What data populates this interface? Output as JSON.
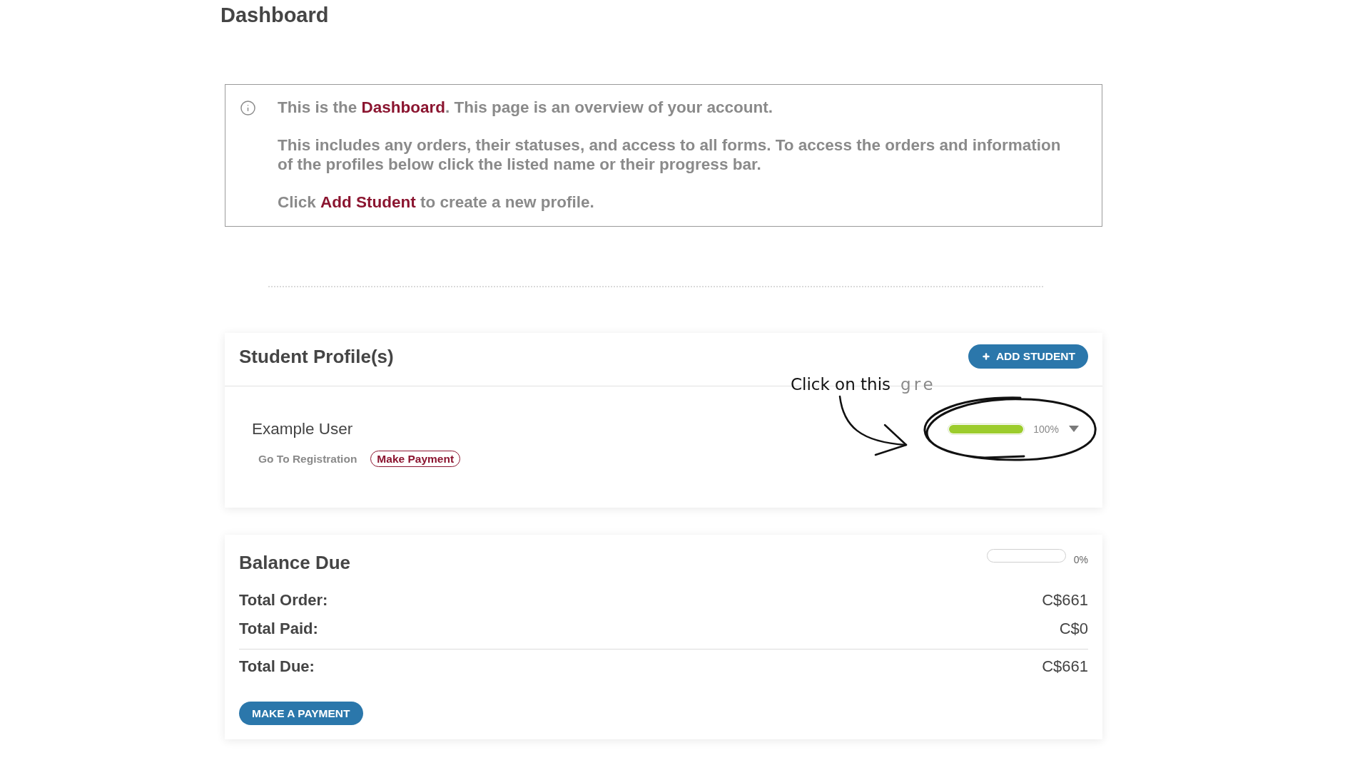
{
  "page_title": "Dashboard",
  "info_box": {
    "paragraphs": [
      "This is the **Dashboard**. This page is an overview of your account.",
      "This includes any orders, their statuses, and access to all forms. To access the orders and information of the profiles below click the listed name or their progress bar.",
      "Click **Add Student** to create a new profile."
    ]
  },
  "student_profiles": {
    "title": "Student Profile(s)",
    "add_button": {
      "label": "ADD STUDENT"
    },
    "students": [
      {
        "name": "Example User",
        "actions": [
          {
            "kind": "link",
            "label": "Go To Registration"
          },
          {
            "kind": "pill",
            "label": "Make Payment"
          }
        ],
        "level": 1,
        "reading": "100%"
      }
    ]
  },
  "annotation": {
    "text": "Click on this",
    "partial_text": "gre"
  },
  "balance_due": {
    "title": "Balance Due",
    "level": 0,
    "reading": "0%",
    "rows": [
      {
        "kind": "line",
        "label": "Total Order:",
        "value": "C$661"
      },
      {
        "kind": "line",
        "label": "Total Paid:",
        "value": "C$0"
      },
      {
        "kind": "total",
        "label": "Total Due:",
        "value": "C$661"
      }
    ],
    "button": {
      "label": "MAKE A PAYMENT"
    }
  }
}
